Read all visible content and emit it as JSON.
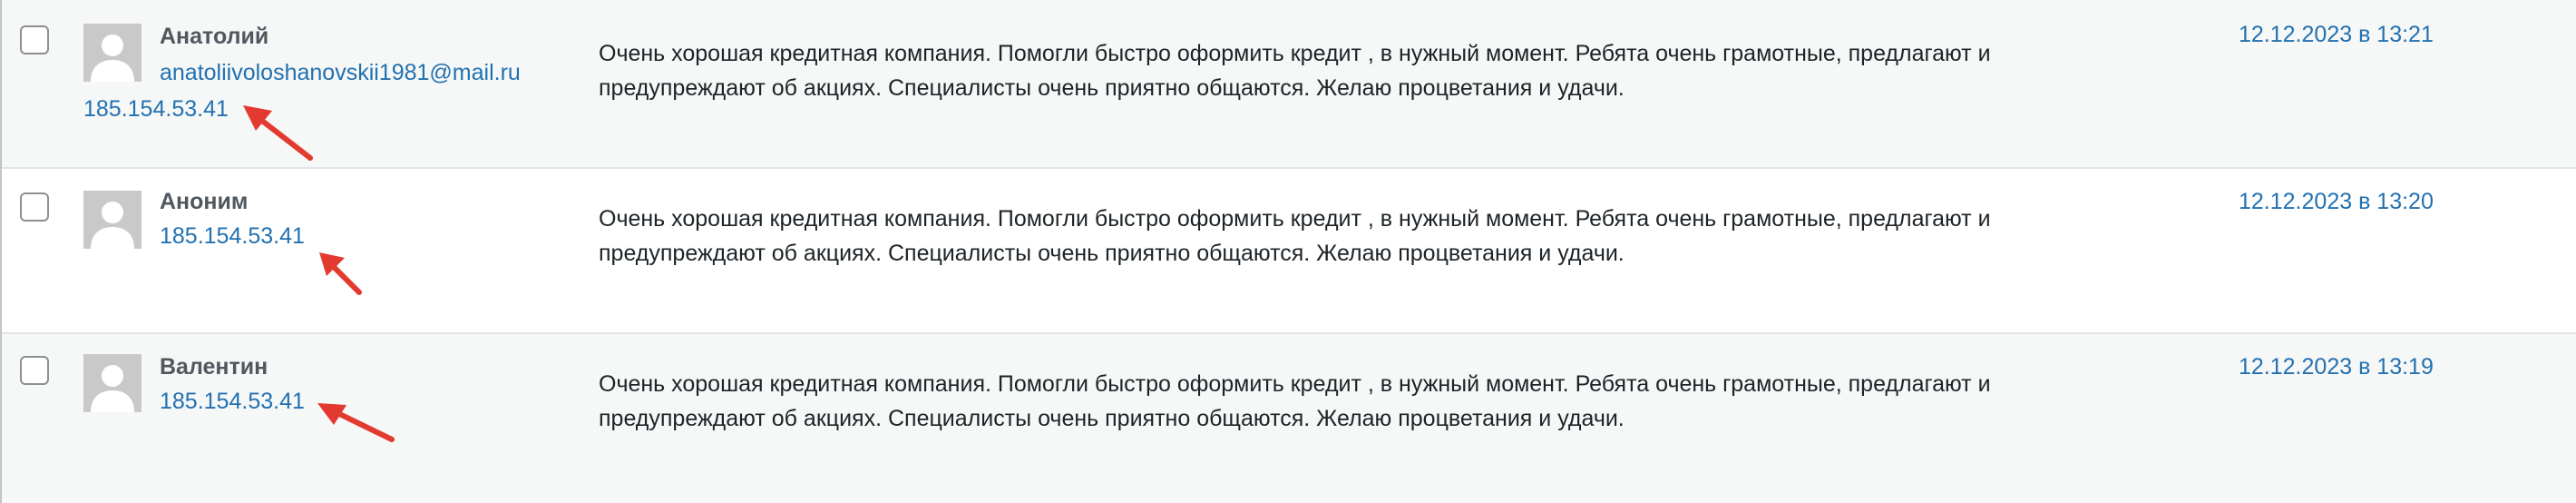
{
  "comments": [
    {
      "author": "Анатолий",
      "email": "anatoliivoloshanovskii1981@mail.ru",
      "ip": "185.154.53.41",
      "text_line1": "Очень хорошая кредитная компания. Помогли быстро оформить кредит , в нужный момент. Ребята очень грамотные, предлагают и",
      "text_line2": "предупреждают об акциях. Специалисты очень приятно общаются. Желаю процветания и удачи.",
      "date": "12.12.2023 в 13:21"
    },
    {
      "author": "Аноним",
      "ip": "185.154.53.41",
      "text_line1": "Очень хорошая кредитная компания. Помогли быстро оформить кредит , в нужный момент. Ребята очень грамотные, предлагают и",
      "text_line2": "предупреждают об акциях. Специалисты очень приятно общаются. Желаю процветания и удачи.",
      "date": "12.12.2023 в 13:20"
    },
    {
      "author": "Валентин",
      "ip": "185.154.53.41",
      "text_line1": "Очень хорошая кредитная компания. Помогли быстро оформить кредит , в нужный момент. Ребята очень грамотные, предлагают и",
      "text_line2": "предупреждают об акциях. Специалисты очень приятно общаются. Желаю процветания и удачи.",
      "date": "12.12.2023 в 13:19"
    }
  ],
  "colors": {
    "link": "#2271b1",
    "annotation_arrow": "#e23a2e",
    "row_alt_bg": "#f6f7f7"
  },
  "icons": {
    "avatar": "default-avatar-icon",
    "annotation": "red-arrow-annotation"
  }
}
